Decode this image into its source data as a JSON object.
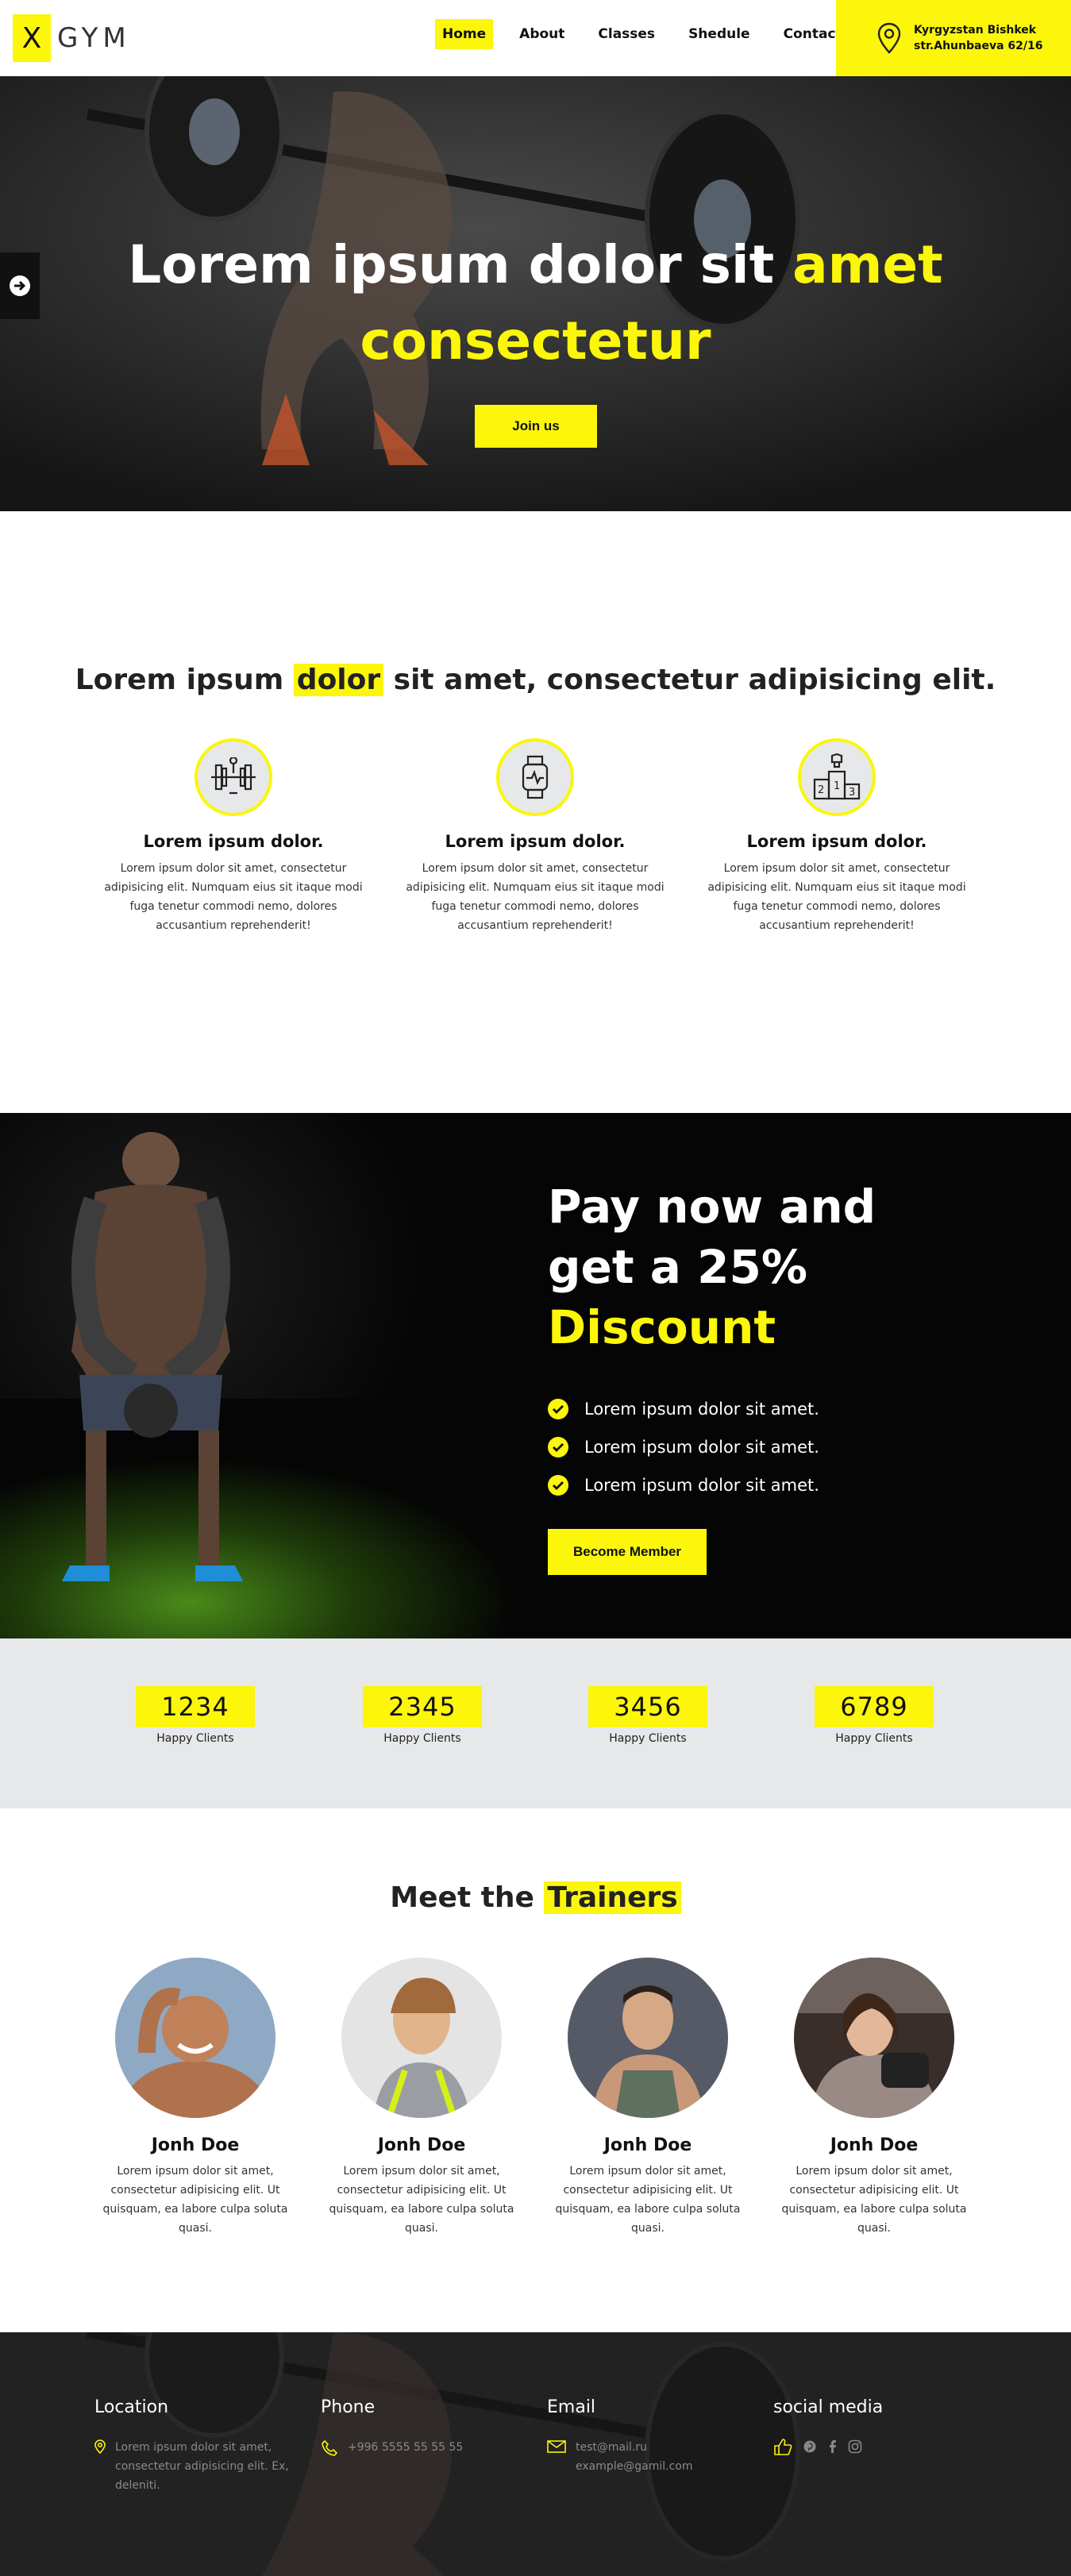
{
  "header": {
    "logo_mark": "X",
    "logo_text": "GYM",
    "nav": [
      "Home",
      "About",
      "Classes",
      "Shedule",
      "Contact"
    ],
    "location_line1": "Kyrgyzstan Bishkek",
    "location_line2": "str.Ahunbaeva 62/16"
  },
  "hero": {
    "title_white_1": "Lorem ipsum dolor sit ",
    "title_yellow_1": "amet",
    "title_yellow_2": "consectetur",
    "button": "Join us"
  },
  "features": {
    "heading_before": "Lorem ipsum ",
    "heading_highlight": "dolor",
    "heading_after": " sit amet, consectetur adipisicing elit.",
    "items": [
      {
        "icon": "barbell-icon",
        "title": "Lorem ipsum dolor.",
        "text": "Lorem ipsum dolor sit amet, consectetur adipisicing elit. Numquam eius sit itaque modi fuga tenetur commodi nemo, dolores accusantium reprehenderit!"
      },
      {
        "icon": "smartwatch-icon",
        "title": "Lorem ipsum dolor.",
        "text": "Lorem ipsum dolor sit amet, consectetur adipisicing elit. Numquam eius sit itaque modi fuga tenetur commodi nemo, dolores accusantium reprehenderit!"
      },
      {
        "icon": "podium-icon",
        "title": "Lorem ipsum dolor.",
        "text": "Lorem ipsum dolor sit amet, consectetur adipisicing elit. Numquam eius sit itaque modi fuga tenetur commodi nemo, dolores accusantium reprehenderit!"
      }
    ]
  },
  "discount": {
    "line1": "Pay now and",
    "line2": "get a 25%",
    "line3": "Discount",
    "checks": [
      "Lorem ipsum dolor sit amet.",
      "Lorem ipsum dolor sit amet.",
      "Lorem ipsum dolor sit amet."
    ],
    "button": "Become Member"
  },
  "stats": [
    {
      "value": "1234",
      "label": "Happy Clients"
    },
    {
      "value": "2345",
      "label": "Happy Clients"
    },
    {
      "value": "3456",
      "label": "Happy Clients"
    },
    {
      "value": "6789",
      "label": "Happy Clients"
    }
  ],
  "trainers": {
    "heading_before": "Meet the ",
    "heading_highlight": "Trainers",
    "items": [
      {
        "name": "Jonh Doe",
        "text": "Lorem ipsum dolor sit amet, consectetur adipisicing elit. Ut quisquam, ea labore culpa soluta quasi."
      },
      {
        "name": "Jonh Doe",
        "text": "Lorem ipsum dolor sit amet, consectetur adipisicing elit. Ut quisquam, ea labore culpa soluta quasi."
      },
      {
        "name": "Jonh Doe",
        "text": "Lorem ipsum dolor sit amet, consectetur adipisicing elit. Ut quisquam, ea labore culpa soluta quasi."
      },
      {
        "name": "Jonh Doe",
        "text": "Lorem ipsum dolor sit amet, consectetur adipisicing elit. Ut quisquam, ea labore culpa soluta quasi."
      }
    ]
  },
  "footer": {
    "location_title": "Location",
    "location_text": "Lorem ipsum dolor sit amet, consectetur adipisicing elit. Ex, deleniti.",
    "phone_title": "Phone",
    "phone_text": "+996 5555 55 55 55",
    "email_title": "Email",
    "email_line1": "test@mail.ru",
    "email_line2": "example@gamil.com",
    "social_title": "social media",
    "social_icons": [
      "thumbs-up-icon",
      "pinterest-icon",
      "facebook-icon",
      "instagram-icon"
    ]
  },
  "colors": {
    "accent": "#fbf60a",
    "dark": "#111111",
    "light_gray": "#e7e8ea"
  }
}
